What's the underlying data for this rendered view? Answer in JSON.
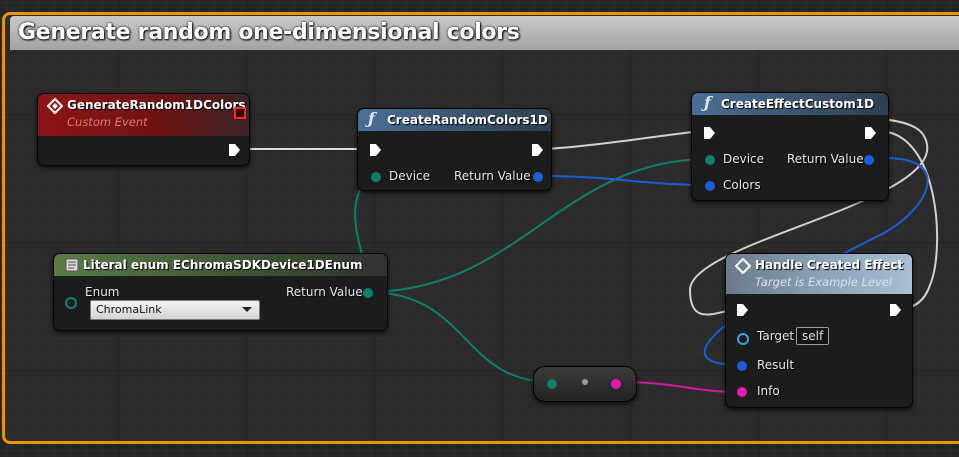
{
  "comment": {
    "title": "Generate random one-dimensional colors"
  },
  "nodes": {
    "custom_event": {
      "title": "GenerateRandom1DColors",
      "subtitle": "Custom Event"
    },
    "create_random": {
      "title": "CreateRandomColors1D",
      "pin_device": "Device",
      "pin_return": "Return Value"
    },
    "create_effect": {
      "title": "CreateEffectCustom1D",
      "pin_device": "Device",
      "pin_colors": "Colors",
      "pin_return": "Return Value"
    },
    "literal_enum": {
      "title": "Literal enum EChromaSDKDevice1DEnum",
      "pin_enum": "Enum",
      "pin_return": "Return Value",
      "enum_value": "ChromaLink"
    },
    "handle_effect": {
      "title": "Handle Created Effect",
      "subtitle": "Target is Example Level",
      "pin_target": "Target",
      "target_default": "self",
      "pin_result": "Result",
      "pin_info": "Info"
    }
  },
  "colors": {
    "comment_border": "#e69500",
    "exec_wire": "#dcdcdc",
    "enum_wire": "#0d7f6b",
    "int_wire": "#1b5fd6",
    "struct_wire": "#d11aa0",
    "event_header": "#8e1515",
    "function_header": "#4a6f96",
    "pure_header": "#5b7a45"
  },
  "icons": {
    "event": "diamond-event-icon",
    "function": "function-f-icon",
    "literal": "literal-page-icon",
    "macro": "diamond-macro-icon"
  }
}
